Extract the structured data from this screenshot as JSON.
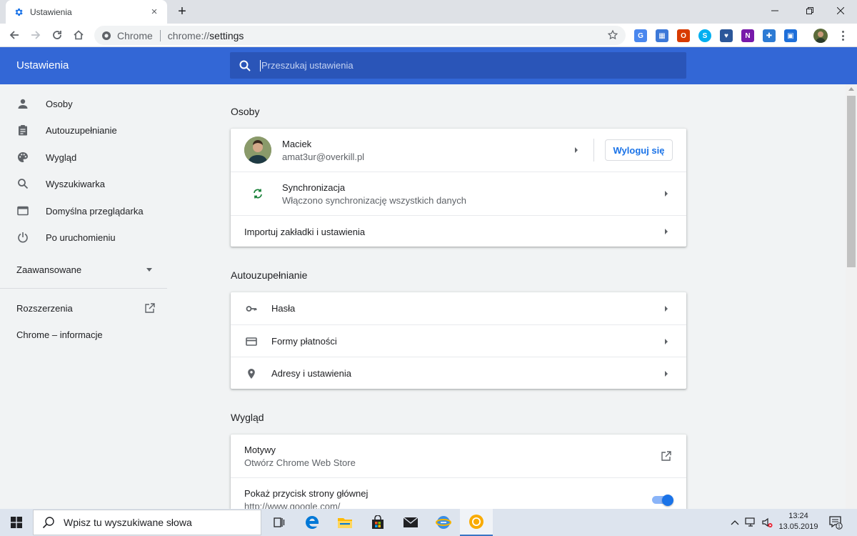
{
  "browser": {
    "tab_title": "Ustawienia",
    "tab_close": "×",
    "new_tab": "+",
    "omnibox_site": "Chrome",
    "omnibox_url_scheme": "chrome://",
    "omnibox_url_path": "settings"
  },
  "header": {
    "title": "Ustawienia",
    "search_placeholder": "Przeszukaj ustawienia"
  },
  "sidebar": {
    "items": [
      {
        "label": "Osoby",
        "icon": "person-icon"
      },
      {
        "label": "Autouzupełnianie",
        "icon": "clipboard-icon"
      },
      {
        "label": "Wygląd",
        "icon": "palette-icon"
      },
      {
        "label": "Wyszukiwarka",
        "icon": "search-icon"
      },
      {
        "label": "Domyślna przeglądarka",
        "icon": "browser-window-icon"
      },
      {
        "label": "Po uruchomieniu",
        "icon": "power-icon"
      }
    ],
    "advanced": "Zaawansowane",
    "extensions": "Rozszerzenia",
    "about": "Chrome – informacje"
  },
  "sections": {
    "people": {
      "title": "Osoby",
      "user_name": "Maciek",
      "user_email": "amat3ur@overkill.pl",
      "signout": "Wyloguj się",
      "sync_title": "Synchronizacja",
      "sync_sub": "Włączono synchronizację wszystkich danych",
      "import": "Importuj zakładki i ustawienia"
    },
    "autofill": {
      "title": "Autouzupełnianie",
      "passwords": "Hasła",
      "payments": "Formy płatności",
      "addresses": "Adresy i ustawienia"
    },
    "appearance": {
      "title": "Wygląd",
      "themes_title": "Motywy",
      "themes_sub": "Otwórz Chrome Web Store",
      "home_title": "Pokaż przycisk strony głównej",
      "home_sub": "http://www.google.com/",
      "home_enabled": true
    }
  },
  "taskbar": {
    "search_placeholder": "Wpisz tu wyszukiwane słowa",
    "time": "13:24",
    "date": "13.05.2019",
    "notification_count": "1"
  },
  "colors": {
    "header_blue": "#3367d6",
    "accent_blue": "#1a73e8",
    "sync_green": "#188038"
  }
}
